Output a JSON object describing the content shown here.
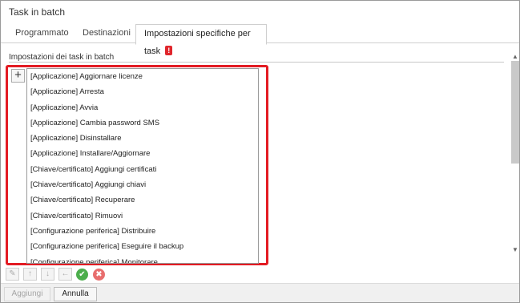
{
  "window": {
    "title": "Task in batch"
  },
  "tabs": [
    {
      "label": "Programmato"
    },
    {
      "label": "Destinazioni"
    },
    {
      "label": "Impostazioni specifiche per task",
      "badge": "!"
    }
  ],
  "section": {
    "label": "Impostazioni dei task in batch"
  },
  "add_symbol": "+",
  "items": [
    "[Applicazione] Aggiornare licenze",
    "[Applicazione] Arresta",
    "[Applicazione] Avvia",
    "[Applicazione] Cambia password SMS",
    "[Applicazione] Disinstallare",
    "[Applicazione] Installare/Aggiornare",
    "[Chiave/certificato] Aggiungi certificati",
    "[Chiave/certificato] Aggiungi chiavi",
    "[Chiave/certificato] Recuperare",
    "[Chiave/certificato] Rimuovi",
    "[Configurazione periferica] Distribuire",
    "[Configurazione periferica] Eseguire il backup",
    "[Configurazione periferica] Monitorare"
  ],
  "toolbar": {
    "edit_icon": "edit-icon",
    "up_icon": "arrow-up-icon",
    "down_icon": "arrow-down-icon",
    "left_icon": "arrow-left-icon",
    "ok_icon": "check-icon",
    "cancel_icon": "close-icon"
  },
  "footer": {
    "add_label": "Aggiungi",
    "cancel_label": "Annulla"
  },
  "colors": {
    "highlight_border": "#e31b23",
    "badge": "#e0262c",
    "ok": "#4cae4c",
    "cancel": "#e86e6e"
  }
}
